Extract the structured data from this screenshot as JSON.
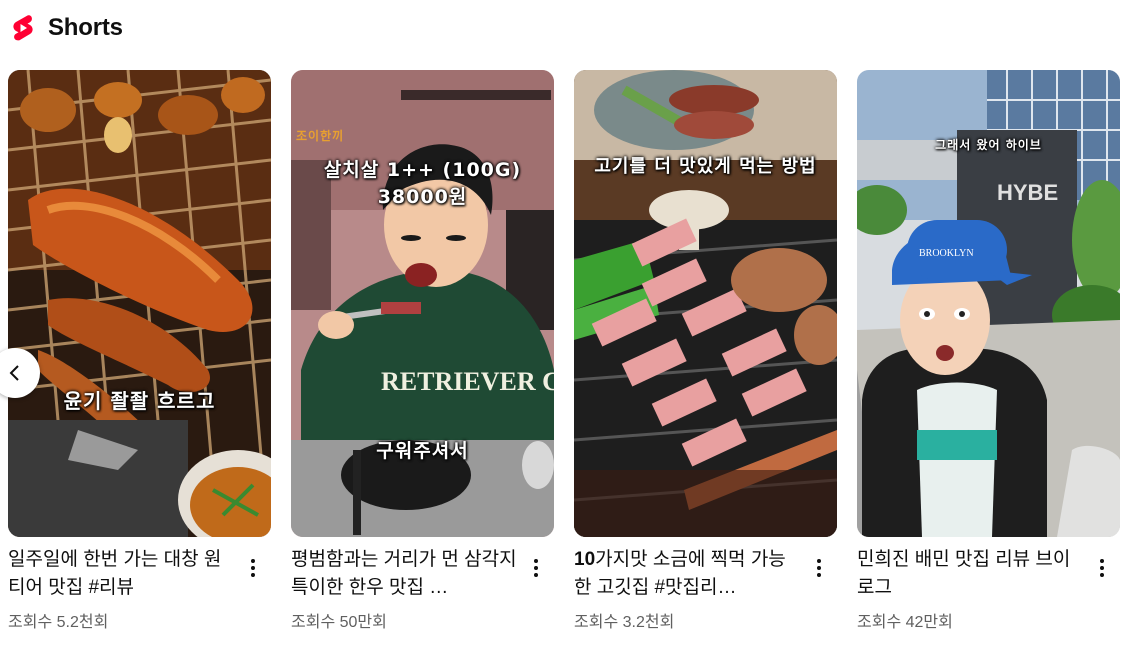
{
  "header": {
    "title": "Shorts",
    "logo_icon": "youtube-shorts-logo",
    "accent": "#ff0033"
  },
  "cards": [
    {
      "overlay": "윤기 좔좔 흐르고",
      "title": "일주일에 한번 가는 대창 원티어 맛집 #리뷰",
      "views": "조회수 5.2천회"
    },
    {
      "badge": "조이한끼",
      "overlay_top_line1": "살치살 1++ (100G)",
      "overlay_top_line2": "38000원",
      "overlay": "구워주셔서",
      "title": "평범함과는 거리가 먼 삼각지 특이한 한우 맛집 …",
      "views": "조회수 50만회"
    },
    {
      "overlay": "고기를 더 맛있게 먹는 방법",
      "title_bold_part": "10",
      "title": "가지맛 소금에 찍먹 가능한 고깃집 #맛집리…",
      "views": "조회수 3.2천회"
    },
    {
      "overlay": "그래서 왔어 하이브",
      "sign": "HYBE",
      "title": "민희진 배민 맛집 리뷰 브이로그",
      "views": "조회수 42만회"
    }
  ],
  "icons": {
    "more": "more-vert-icon",
    "prev": "chevron-left-icon"
  }
}
